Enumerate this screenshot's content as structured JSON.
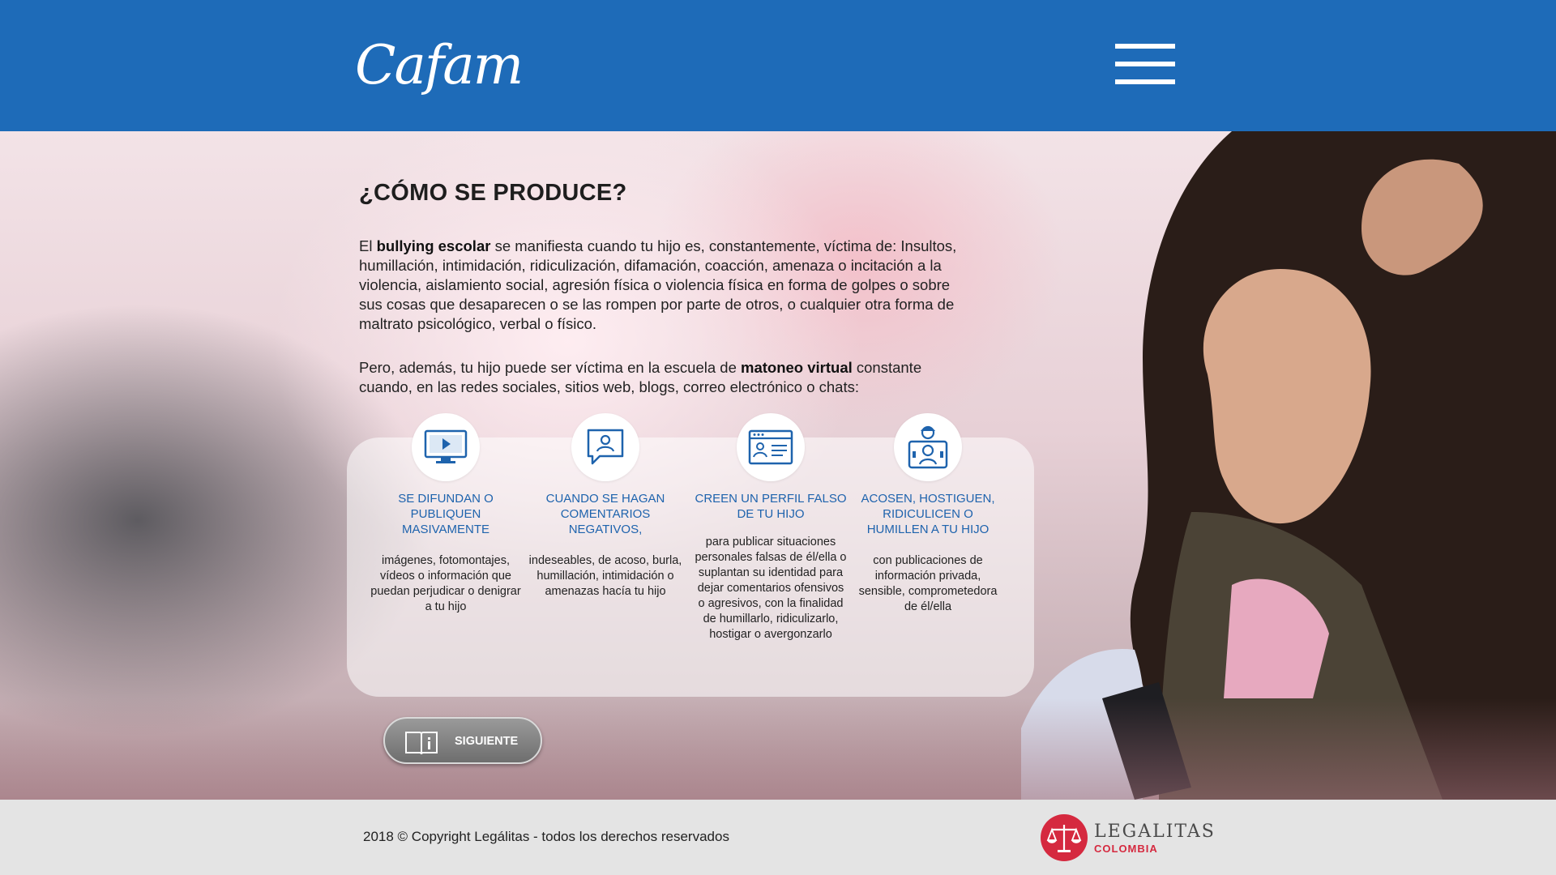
{
  "header": {
    "logo_text": "Cafam",
    "menu_icon": "hamburger-menu-icon",
    "color": "#1e6bb8"
  },
  "main": {
    "title": "¿CÓMO SE PRODUCE?",
    "paragraph1": {
      "before": "El ",
      "bold": "bullying escolar",
      "after": " se manifiesta cuando tu hijo es, constantemente, víctima de: Insultos, humillación, intimidación, ridiculización, difamación, coacción, amenaza o incitación a la violencia, aislamiento social, agresión física o violencia física en forma de golpes o sobre sus cosas que desaparecen o se las rompen por parte de otros, o cualquier otra forma de maltrato psicológico, verbal o físico."
    },
    "paragraph2": {
      "before": "Pero, además, tu hijo puede ser víctima en la escuela de ",
      "bold": "matoneo virtual",
      "after": " constante cuando, en las redes sociales, sitios web, blogs, correo electrónico o chats:"
    },
    "cards": [
      {
        "icon": "video-screen-icon",
        "title": "SE DIFUNDAN O PUBLIQUEN MASIVAMENTE",
        "text": "imágenes, fotomontajes, vídeos o información que puedan perjudicar o denigrar a tu hijo"
      },
      {
        "icon": "comment-profile-icon",
        "title": "CUANDO SE HAGAN COMENTARIOS NEGATIVOS,",
        "text": "indeseables, de acoso, burla, humillación, intimidación o amenazas hacía tu hijo"
      },
      {
        "icon": "fake-profile-icon",
        "title": "CREEN UN PERFIL FALSO DE TU HIJO",
        "text": "para publicar situaciones personales falsas de él/ella o suplantan su identidad para dejar comentarios ofensivos o agresivos, con la finalidad de humillarlo, ridiculizarlo, hostigar o avergonzarlo"
      },
      {
        "icon": "harassment-users-icon",
        "title": "ACOSEN, HOSTIGUEN, RIDICULICEN O HUMILLEN A TU HIJO",
        "text": "con publicaciones de información privada, sensible, comprometedora de él/ella"
      }
    ],
    "next_button": {
      "label": "SIGUIENTE",
      "icon": "book-info-icon"
    }
  },
  "footer": {
    "copyright": "2018 © Copyright Legálitas - todos los derechos reservados",
    "partner_name": "LEGALITAS",
    "partner_sub": "COLOMBIA",
    "partner_icon": "scales-of-justice-icon",
    "partner_color": "#d5293f"
  }
}
